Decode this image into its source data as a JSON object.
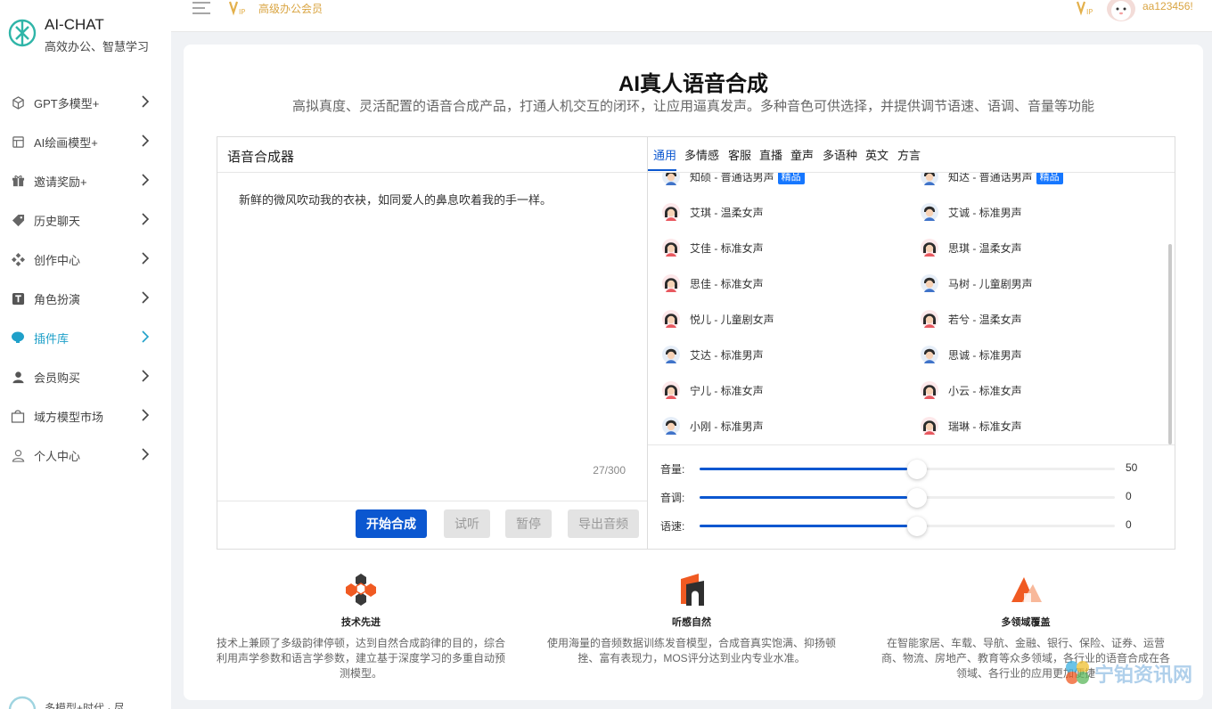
{
  "brand": {
    "name": "AI-CHAT",
    "tagline": "高效办公、智慧学习"
  },
  "sidebar": {
    "items": [
      {
        "label": "GPT多模型+",
        "icon": "cube-icon"
      },
      {
        "label": "AI绘画模型+",
        "icon": "palette-icon"
      },
      {
        "label": "邀请奖励+",
        "icon": "gift-icon"
      },
      {
        "label": "历史聊天",
        "icon": "tag-icon"
      },
      {
        "label": "创作中心",
        "icon": "diamond-grid-icon"
      },
      {
        "label": "角色扮演",
        "icon": "text-box-icon"
      },
      {
        "label": "插件库",
        "icon": "bulb-icon",
        "active": true
      },
      {
        "label": "会员购买",
        "icon": "user-icon"
      },
      {
        "label": "域方模型市场",
        "icon": "bag-icon"
      },
      {
        "label": "个人中心",
        "icon": "person-outline-icon"
      }
    ],
    "bottom_text": "多模型+时代 · 尽"
  },
  "topbar": {
    "vip_label": "高级办公会员",
    "username": "aa123456!"
  },
  "page": {
    "title": "AI真人语音合成",
    "subtitle": "高拟真度、灵活配置的语音合成产品，打通人机交互的闭环，让应用逼真发声。多种音色可供选择，并提供调节语速、语调、音量等功能"
  },
  "synth": {
    "panel_title": "语音合成器",
    "text": "新鲜的微风吹动我的衣袂，如同爱人的鼻息吹着我的手一样。",
    "char_count": "27/300",
    "buttons": {
      "start": "开始合成",
      "listen": "试听",
      "pause": "暂停",
      "export": "导出音频"
    }
  },
  "voices": {
    "tabs": [
      "通用",
      "多情感",
      "客服",
      "直播",
      "童声",
      "多语种",
      "英文",
      "方言"
    ],
    "active_tab": "通用",
    "left": [
      {
        "name": "知硕 - 普通话男声",
        "badge": "精品",
        "gender": "male"
      },
      {
        "name": "艾琪 - 温柔女声",
        "gender": "female"
      },
      {
        "name": "艾佳 - 标准女声",
        "gender": "female"
      },
      {
        "name": "思佳 - 标准女声",
        "gender": "female"
      },
      {
        "name": "悦儿 - 儿童剧女声",
        "gender": "female"
      },
      {
        "name": "艾达 - 标准男声",
        "gender": "male"
      },
      {
        "name": "宁儿 - 标准女声",
        "gender": "female"
      },
      {
        "name": "小刚 - 标准男声",
        "gender": "male"
      }
    ],
    "right": [
      {
        "name": "知达 - 普通话男声",
        "badge": "精品",
        "gender": "male"
      },
      {
        "name": "艾诚 - 标准男声",
        "gender": "male"
      },
      {
        "name": "思琪 - 温柔女声",
        "gender": "female"
      },
      {
        "name": "马树 - 儿童剧男声",
        "gender": "male"
      },
      {
        "name": "若兮 - 温柔女声",
        "gender": "female"
      },
      {
        "name": "思诚 - 标准男声",
        "gender": "male"
      },
      {
        "name": "小云 - 标准女声",
        "gender": "female"
      },
      {
        "name": "瑞琳 - 标准女声",
        "gender": "female"
      }
    ]
  },
  "sliders": [
    {
      "label": "音量:",
      "value": "50",
      "fraction": 0.5
    },
    {
      "label": "音调:",
      "value": "0",
      "fraction": 0.5
    },
    {
      "label": "语速:",
      "value": "0",
      "fraction": 0.5
    }
  ],
  "features": [
    {
      "title": "技术先进",
      "desc": "技术上兼顾了多级韵律停顿，达到自然合成韵律的目的，综合利用声学参数和语言学参数，建立基于深度学习的多重自动预测模型。"
    },
    {
      "title": "听感自然",
      "desc": "使用海量的音频数据训练发音模型，合成音真实饱满、抑扬顿挫、富有表现力，MOS评分达到业内专业水准。"
    },
    {
      "title": "多领域覆盖",
      "desc": "在智能家居、车载、导航、金融、银行、保险、证券、运营商、物流、房地产、教育等众多领域，各行业的语音合成在各领域、各行业的应用更加便捷"
    }
  ],
  "watermark": "宁铂资讯网",
  "colors": {
    "primary": "#0b57d0",
    "active_nav": "#1fa0c9",
    "vip_gold": "#d9a441"
  }
}
